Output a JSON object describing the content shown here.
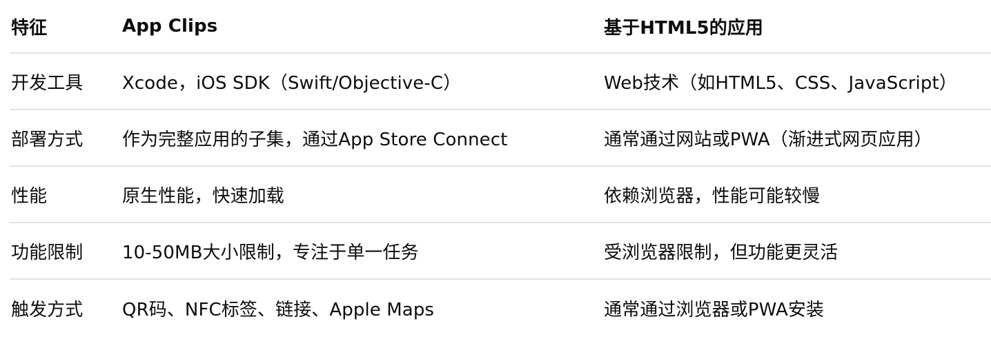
{
  "table": {
    "headers": [
      "特征",
      "App Clips",
      "基于HTML5的应用"
    ],
    "rows": [
      [
        "开发工具",
        "Xcode，iOS SDK（Swift/Objective-C）",
        "Web技术（如HTML5、CSS、JavaScript）"
      ],
      [
        "部署方式",
        "作为完整应用的子集，通过App Store Connect",
        "通常通过网站或PWA（渐进式网页应用）"
      ],
      [
        "性能",
        "原生性能，快速加载",
        "依赖浏览器，性能可能较慢"
      ],
      [
        "功能限制",
        "10-50MB大小限制，专注于单一任务",
        "受浏览器限制，但功能更灵活"
      ],
      [
        "触发方式",
        "QR码、NFC标签、链接、Apple Maps",
        "通常通过浏览器或PWA安装"
      ]
    ]
  }
}
